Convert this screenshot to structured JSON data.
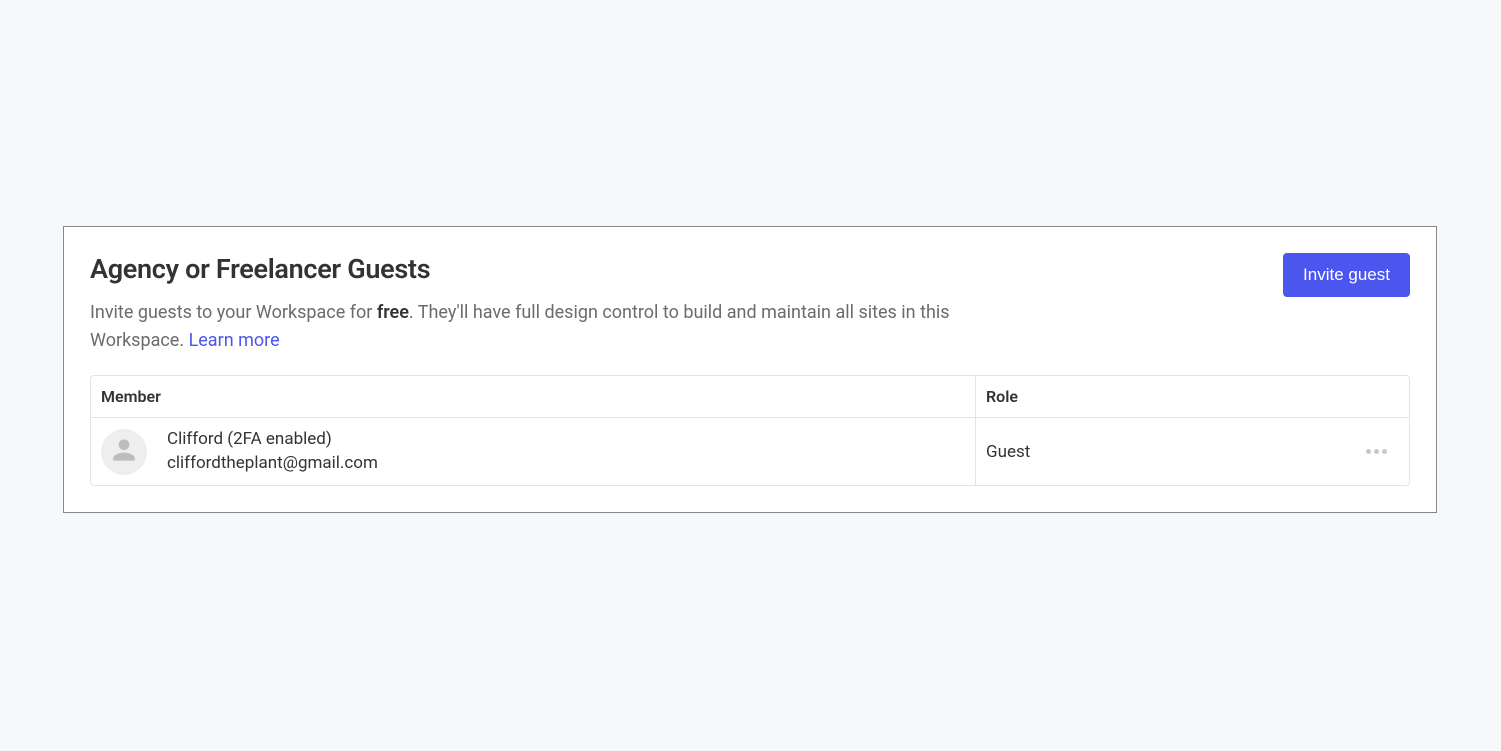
{
  "panel": {
    "title": "Agency or Freelancer Guests",
    "description_prefix": "Invite guests to your Workspace for ",
    "description_bold": "free",
    "description_suffix": ". They'll have full design control to build and maintain all sites in this Workspace. ",
    "learn_more": "Learn more",
    "invite_button": "Invite guest"
  },
  "table": {
    "header_member": "Member",
    "header_role": "Role",
    "rows": [
      {
        "name": "Clifford (2FA enabled)",
        "email": "cliffordtheplant@gmail.com",
        "role": "Guest"
      }
    ]
  }
}
